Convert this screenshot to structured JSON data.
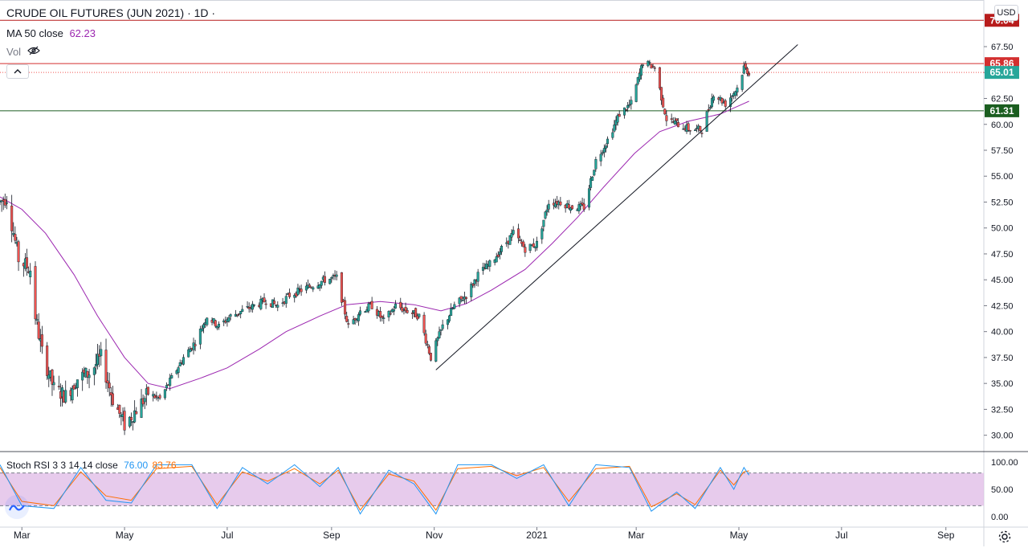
{
  "header": {
    "symbol": "CRUDE OIL FUTURES (JUN 2021) · 1D ·",
    "ma_label": "MA 50 close",
    "ma_value": "62.23",
    "vol_label": "Vol",
    "currency": "USD"
  },
  "stoch": {
    "label": "Stoch RSI 3 3 14 14 close",
    "k_value": "76.00",
    "d_value": "83.76",
    "levels": [
      "100.00",
      "50.00",
      "0.00"
    ]
  },
  "colors": {
    "up": "#26a69a",
    "down": "#ef5350",
    "ma": "#9c27b0",
    "resistance": "#b71c1c",
    "support": "#1b5e20",
    "stoch_k": "#2196f3",
    "stoch_d": "#ff6d00",
    "stoch_band": "#e1bee7"
  },
  "chart_data": {
    "type": "candlestick",
    "x_ticks": [
      "Mar",
      "May",
      "Jul",
      "Sep",
      "Nov",
      "2021",
      "Mar",
      "May",
      "Jul",
      "Sep"
    ],
    "y_ticks": [
      "67.50",
      "65.00",
      "62.50",
      "60.00",
      "57.50",
      "55.00",
      "52.50",
      "50.00",
      "47.50",
      "45.00",
      "42.50",
      "40.00",
      "37.50",
      "35.00",
      "32.50",
      "30.00"
    ],
    "price_labels": [
      {
        "value": "70.04",
        "role": "resistance"
      },
      {
        "value": "65.86",
        "role": "high"
      },
      {
        "value": "65.01",
        "role": "last"
      },
      {
        "value": "61.31",
        "role": "support"
      }
    ],
    "ylim": [
      28.5,
      72
    ],
    "close_path": [
      [
        "2020-02-17",
        52.5
      ],
      [
        "2020-02-21",
        53.0
      ],
      [
        "2020-02-28",
        47.0
      ],
      [
        "2020-03-06",
        46.0
      ],
      [
        "2020-03-09",
        41.5
      ],
      [
        "2020-03-13",
        38.0
      ],
      [
        "2020-03-20",
        34.5
      ],
      [
        "2020-03-27",
        33.8
      ],
      [
        "2020-04-03",
        35.5
      ],
      [
        "2020-04-10",
        36.0
      ],
      [
        "2020-04-17",
        37.5
      ],
      [
        "2020-04-24",
        33.5
      ],
      [
        "2020-05-01",
        31.0
      ],
      [
        "2020-05-08",
        32.5
      ],
      [
        "2020-05-15",
        34.0
      ],
      [
        "2020-05-22",
        33.5
      ],
      [
        "2020-05-29",
        35.5
      ],
      [
        "2020-06-05",
        37.5
      ],
      [
        "2020-06-12",
        39.0
      ],
      [
        "2020-06-19",
        41.5
      ],
      [
        "2020-06-26",
        40.5
      ],
      [
        "2020-07-03",
        41.5
      ],
      [
        "2020-07-10",
        42.0
      ],
      [
        "2020-07-17",
        42.5
      ],
      [
        "2020-07-24",
        43.0
      ],
      [
        "2020-07-31",
        42.5
      ],
      [
        "2020-08-07",
        43.5
      ],
      [
        "2020-08-14",
        44.0
      ],
      [
        "2020-08-21",
        44.5
      ],
      [
        "2020-08-28",
        45.0
      ],
      [
        "2020-09-04",
        45.2
      ],
      [
        "2020-09-11",
        40.5
      ],
      [
        "2020-09-18",
        42.0
      ],
      [
        "2020-09-25",
        42.5
      ],
      [
        "2020-10-02",
        41.0
      ],
      [
        "2020-10-09",
        42.5
      ],
      [
        "2020-10-16",
        42.0
      ],
      [
        "2020-10-23",
        41.5
      ],
      [
        "2020-10-30",
        37.5
      ],
      [
        "2020-11-06",
        40.5
      ],
      [
        "2020-11-13",
        42.5
      ],
      [
        "2020-11-20",
        43.5
      ],
      [
        "2020-11-27",
        45.5
      ],
      [
        "2020-12-04",
        46.5
      ],
      [
        "2020-12-11",
        48.0
      ],
      [
        "2020-12-18",
        49.5
      ],
      [
        "2020-12-25",
        48.0
      ],
      [
        "2021-01-01",
        48.5
      ],
      [
        "2021-01-08",
        52.5
      ],
      [
        "2021-01-15",
        52.5
      ],
      [
        "2021-01-22",
        52.0
      ],
      [
        "2021-01-29",
        52.0
      ],
      [
        "2021-02-05",
        56.5
      ],
      [
        "2021-02-12",
        58.5
      ],
      [
        "2021-02-19",
        61.0
      ],
      [
        "2021-02-26",
        62.0
      ],
      [
        "2021-03-05",
        66.0
      ],
      [
        "2021-03-12",
        65.5
      ],
      [
        "2021-03-19",
        60.5
      ],
      [
        "2021-03-26",
        60.0
      ],
      [
        "2021-04-02",
        59.5
      ],
      [
        "2021-04-09",
        59.5
      ],
      [
        "2021-04-16",
        63.0
      ],
      [
        "2021-04-23",
        62.0
      ],
      [
        "2021-04-30",
        63.5
      ],
      [
        "2021-05-04",
        65.5
      ],
      [
        "2021-05-07",
        65.01
      ]
    ],
    "ma50_path": [
      [
        "2020-02-17",
        53.0
      ],
      [
        "2020-03-01",
        51.8
      ],
      [
        "2020-03-15",
        49.5
      ],
      [
        "2020-04-01",
        45.5
      ],
      [
        "2020-04-15",
        41.5
      ],
      [
        "2020-05-01",
        37.5
      ],
      [
        "2020-05-15",
        35.0
      ],
      [
        "2020-05-28",
        34.5
      ],
      [
        "2020-06-15",
        35.5
      ],
      [
        "2020-07-01",
        36.5
      ],
      [
        "2020-07-20",
        38.3
      ],
      [
        "2020-08-05",
        40.0
      ],
      [
        "2020-08-25",
        41.5
      ],
      [
        "2020-09-10",
        42.6
      ],
      [
        "2020-09-30",
        42.9
      ],
      [
        "2020-10-20",
        42.6
      ],
      [
        "2020-11-05",
        42.0
      ],
      [
        "2020-11-20",
        42.7
      ],
      [
        "2020-12-05",
        44.0
      ],
      [
        "2020-12-25",
        46.0
      ],
      [
        "2021-01-10",
        48.5
      ],
      [
        "2021-01-25",
        51.0
      ],
      [
        "2021-02-10",
        54.0
      ],
      [
        "2021-02-28",
        57.2
      ],
      [
        "2021-03-15",
        59.3
      ],
      [
        "2021-04-01",
        60.3
      ],
      [
        "2021-04-20",
        61.0
      ],
      [
        "2021-05-07",
        62.23
      ]
    ],
    "trendline": [
      [
        "2020-11-02",
        36.3
      ],
      [
        "2021-06-05",
        67.7
      ]
    ],
    "stoch_k": [
      [
        "2020-02-17",
        95
      ],
      [
        "2020-03-01",
        20
      ],
      [
        "2020-03-20",
        15
      ],
      [
        "2020-04-05",
        90
      ],
      [
        "2020-04-20",
        30
      ],
      [
        "2020-05-05",
        25
      ],
      [
        "2020-05-20",
        95
      ],
      [
        "2020-06-10",
        95
      ],
      [
        "2020-06-25",
        15
      ],
      [
        "2020-07-10",
        90
      ],
      [
        "2020-07-25",
        60
      ],
      [
        "2020-08-10",
        95
      ],
      [
        "2020-08-25",
        55
      ],
      [
        "2020-09-05",
        90
      ],
      [
        "2020-09-18",
        5
      ],
      [
        "2020-10-05",
        85
      ],
      [
        "2020-10-20",
        60
      ],
      [
        "2020-11-02",
        5
      ],
      [
        "2020-11-15",
        95
      ],
      [
        "2020-12-05",
        95
      ],
      [
        "2020-12-20",
        70
      ],
      [
        "2021-01-05",
        95
      ],
      [
        "2021-01-20",
        20
      ],
      [
        "2021-02-05",
        95
      ],
      [
        "2021-02-25",
        90
      ],
      [
        "2021-03-10",
        10
      ],
      [
        "2021-03-25",
        45
      ],
      [
        "2021-04-05",
        15
      ],
      [
        "2021-04-20",
        90
      ],
      [
        "2021-04-28",
        50
      ],
      [
        "2021-05-04",
        90
      ],
      [
        "2021-05-07",
        76
      ]
    ],
    "stoch_d": [
      [
        "2020-02-17",
        90
      ],
      [
        "2020-03-01",
        28
      ],
      [
        "2020-03-20",
        20
      ],
      [
        "2020-04-05",
        82
      ],
      [
        "2020-04-20",
        38
      ],
      [
        "2020-05-05",
        30
      ],
      [
        "2020-05-20",
        88
      ],
      [
        "2020-06-10",
        92
      ],
      [
        "2020-06-25",
        22
      ],
      [
        "2020-07-10",
        82
      ],
      [
        "2020-07-25",
        65
      ],
      [
        "2020-08-10",
        88
      ],
      [
        "2020-08-25",
        60
      ],
      [
        "2020-09-05",
        85
      ],
      [
        "2020-09-18",
        12
      ],
      [
        "2020-10-05",
        78
      ],
      [
        "2020-10-20",
        65
      ],
      [
        "2020-11-02",
        12
      ],
      [
        "2020-11-15",
        88
      ],
      [
        "2020-12-05",
        92
      ],
      [
        "2020-12-20",
        75
      ],
      [
        "2021-01-05",
        90
      ],
      [
        "2021-01-20",
        28
      ],
      [
        "2021-02-05",
        88
      ],
      [
        "2021-02-25",
        92
      ],
      [
        "2021-03-10",
        18
      ],
      [
        "2021-03-25",
        42
      ],
      [
        "2021-04-05",
        22
      ],
      [
        "2021-04-20",
        85
      ],
      [
        "2021-04-28",
        58
      ],
      [
        "2021-05-04",
        82
      ],
      [
        "2021-05-07",
        83.76
      ]
    ],
    "stoch_ylim": [
      0,
      100
    ],
    "stoch_band": [
      20,
      80
    ]
  }
}
